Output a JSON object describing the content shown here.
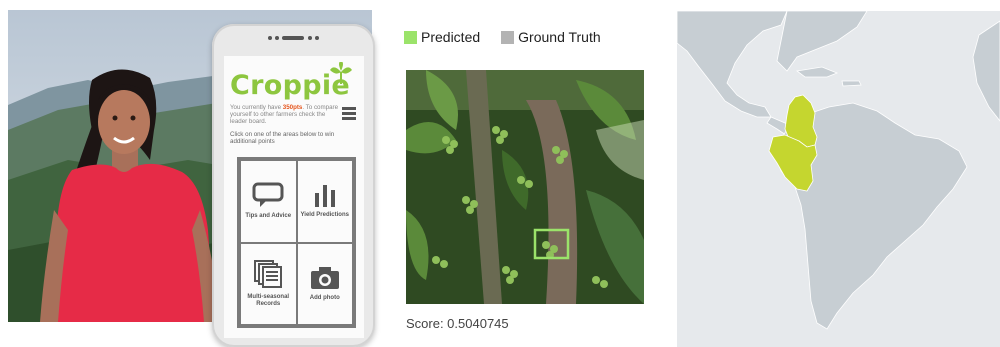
{
  "app": {
    "name": "Croppie",
    "message_pre": "You currently have ",
    "points": "350pts",
    "message_post": ". To compare yourself to other farmers check the leader board.",
    "instruction": "Click on one of the areas below to win additional points",
    "tiles": [
      {
        "label": "Tips and Advice",
        "icon": "chat-bubble-icon"
      },
      {
        "label": "Yield Predictions",
        "icon": "bar-chart-icon"
      },
      {
        "label": "Multi-seasonal Records",
        "icon": "records-icon"
      },
      {
        "label": "Add photo",
        "icon": "camera-icon"
      }
    ]
  },
  "prediction": {
    "legend": [
      {
        "label": "Predicted",
        "color": "#9be36a"
      },
      {
        "label": "Ground Truth",
        "color": "#b3b3b3"
      }
    ],
    "score_text": "Score: 0.5040745"
  },
  "map": {
    "highlight_color": "#c5d62f",
    "land_color": "#c7ced3",
    "ocean_color": "#e6e9ec",
    "highlighted_countries": [
      "Colombia",
      "Peru"
    ]
  }
}
